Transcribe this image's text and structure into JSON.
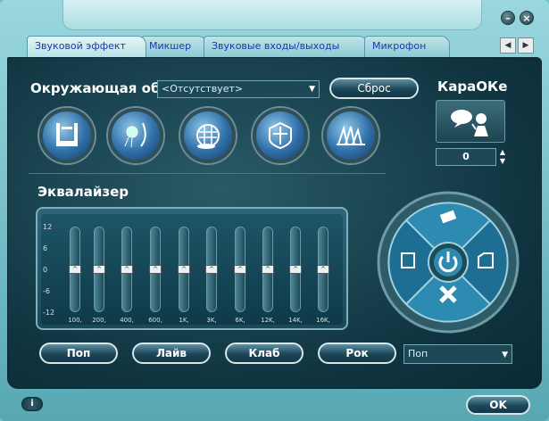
{
  "window": {
    "minimize_icon": "minimize-icon",
    "close_icon": "close-icon"
  },
  "tabs": [
    {
      "label": "Звуковой эффект",
      "active": true
    },
    {
      "label": "Микшер",
      "active": false
    },
    {
      "label": "Звуковые входы/выходы",
      "active": false
    },
    {
      "label": "Микрофон",
      "active": false
    }
  ],
  "environment": {
    "label": "Окружающая обстановка",
    "selected": "<Отсутствует>",
    "reset_label": "Сброс",
    "buttons": [
      {
        "name": "bathroom",
        "icon": "bathroom-icon"
      },
      {
        "name": "shower",
        "icon": "shower-icon"
      },
      {
        "name": "stadium",
        "icon": "stadium-icon"
      },
      {
        "name": "colosseum",
        "icon": "colosseum-icon"
      },
      {
        "name": "opera-house",
        "icon": "opera-house-icon"
      }
    ]
  },
  "karaoke": {
    "title": "КараОКе",
    "icon": "karaoke-icon",
    "value": "0"
  },
  "equalizer": {
    "title": "Эквалайзер",
    "db_labels": [
      "12",
      "6",
      "0",
      "-6",
      "-12"
    ],
    "bands": [
      {
        "freq": "100,",
        "gain": 0
      },
      {
        "freq": "200,",
        "gain": 0
      },
      {
        "freq": "400,",
        "gain": 0
      },
      {
        "freq": "600,",
        "gain": 0
      },
      {
        "freq": "1K,",
        "gain": 0
      },
      {
        "freq": "3K,",
        "gain": 0
      },
      {
        "freq": "6K,",
        "gain": 0
      },
      {
        "freq": "12K,",
        "gain": 0
      },
      {
        "freq": "14K,",
        "gain": 0
      },
      {
        "freq": "16K,",
        "gain": 0
      }
    ],
    "presets": [
      "Поп",
      "Лайв",
      "Клаб",
      "Рок"
    ],
    "preset_selected": "Поп"
  },
  "control_wheel": {
    "center_icon": "power-icon",
    "top_icon": "eraser-icon",
    "left_icon": "save-icon",
    "right_icon": "folder-icon",
    "bottom_icon": "close-x-icon"
  },
  "footer": {
    "info_label": "i",
    "ok_label": "OK"
  },
  "colors": {
    "panel_bg": "#0f3440",
    "accent": "#2f6fa8",
    "window_bg": "#6fc0c8",
    "tab_text": "#1b36a8"
  }
}
